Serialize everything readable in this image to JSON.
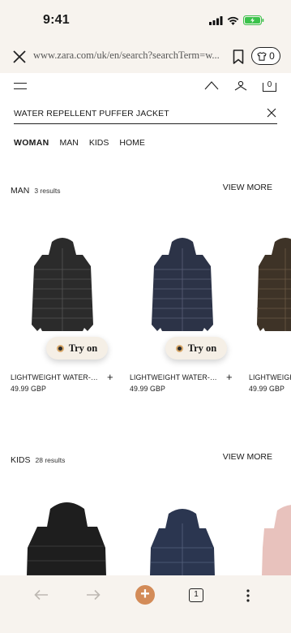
{
  "status_bar": {
    "time": "9:41"
  },
  "browser": {
    "url": "www.zara.com/uk/en/search?searchTerm=w...",
    "tab_count_label": "0"
  },
  "header": {
    "bag_count": "0"
  },
  "search": {
    "query": "WATER REPELLENT PUFFER JACKET"
  },
  "categories": [
    "WOMAN",
    "MAN",
    "KIDS",
    "HOME"
  ],
  "sections": {
    "man": {
      "title": "MAN",
      "count": "3 results",
      "view_more": "VIEW MORE",
      "products": [
        {
          "name": "LIGHTWEIGHT WATER-REPELLENT PUFFER JACKET",
          "price": "49.99 GBP",
          "try_on": "Try on",
          "color": "#2b2b2b"
        },
        {
          "name": "LIGHTWEIGHT WATER-REPELLENT PUFFER JACKET",
          "price": "49.99 GBP",
          "try_on": "Try on",
          "color": "#2c3347"
        },
        {
          "name": "LIGHTWEIGHT WATER-REPELLENT PUFFER JACKET",
          "price": "49.99 GBP",
          "color": "#3e3327"
        }
      ]
    },
    "kids": {
      "title": "KIDS",
      "count": "28 results",
      "view_more": "VIEW MORE",
      "products": [
        {
          "color": "#1e1e1e"
        },
        {
          "color": "#2b3650"
        },
        {
          "color": "#e8c2bd"
        }
      ]
    }
  },
  "bottom_bar": {
    "tab_count": "1",
    "new_tab_symbol": "+"
  },
  "colors": {
    "browser_chrome": "#f7f3ee",
    "accent": "#d38b58"
  }
}
